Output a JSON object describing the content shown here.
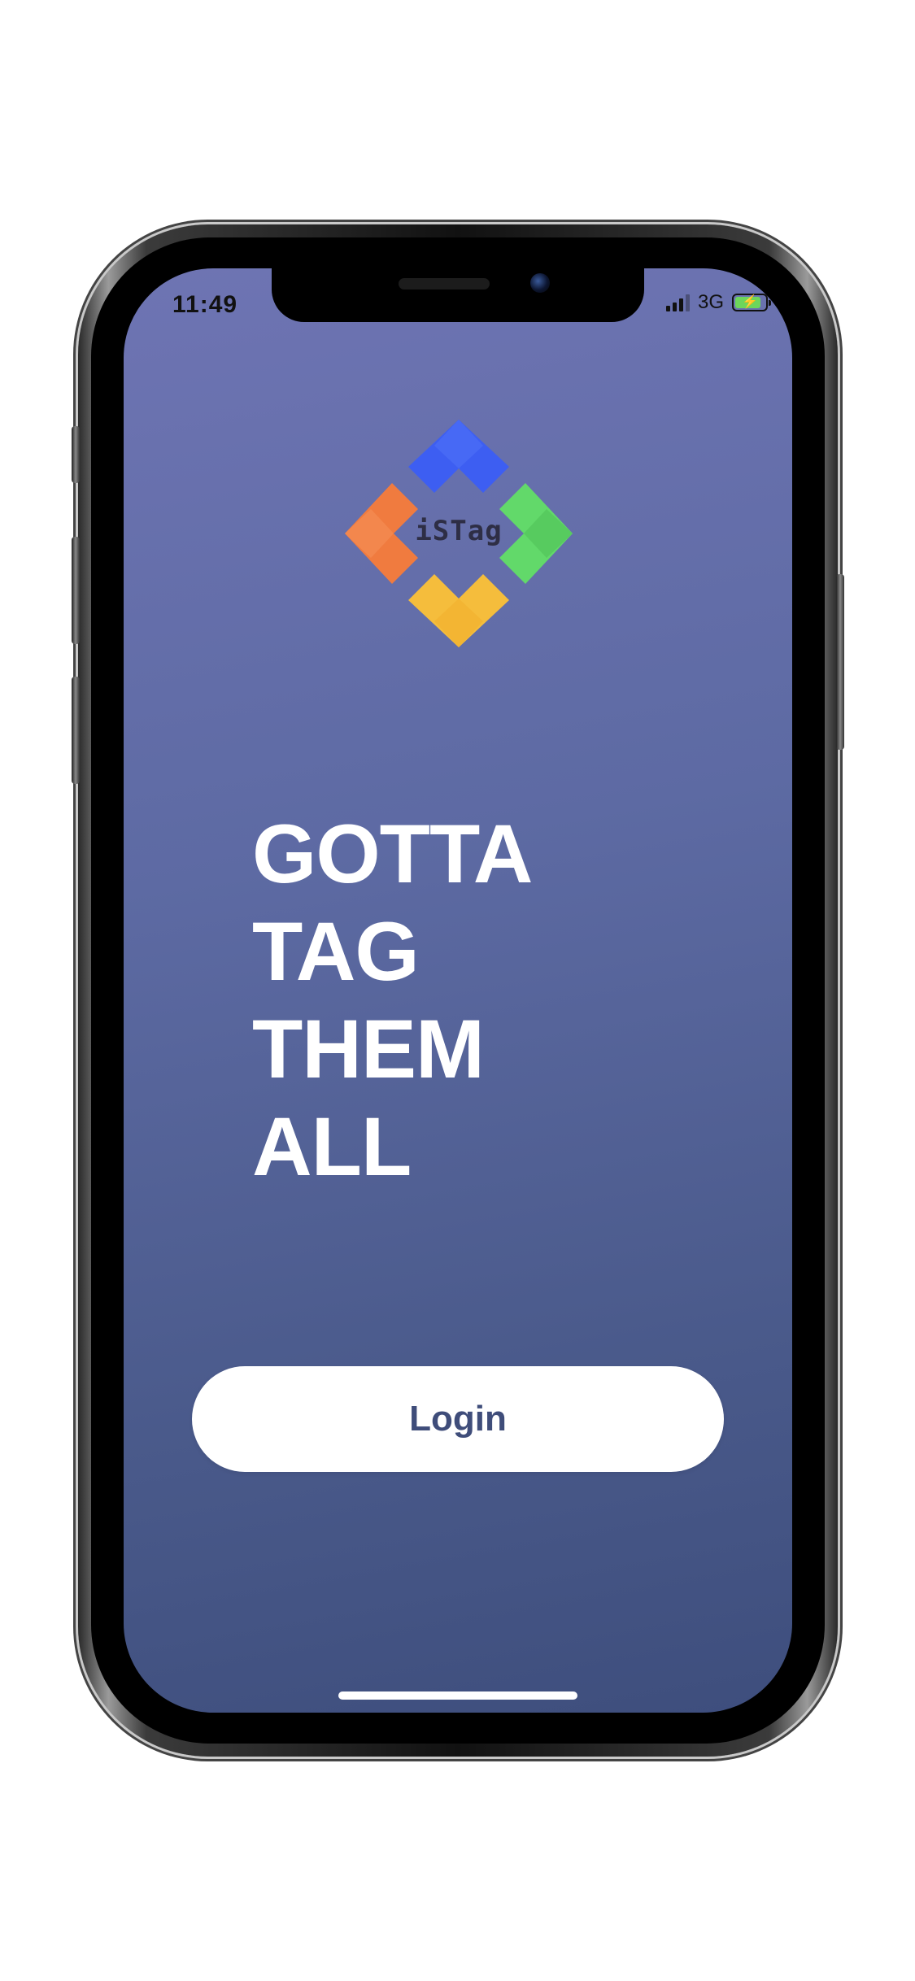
{
  "status_bar": {
    "time": "11:49",
    "network": "3G",
    "signal_icon": "signal-bars-icon",
    "battery_icon": "battery-charging-icon",
    "battery_color": "#6dd65b"
  },
  "logo": {
    "text": "iSTag",
    "icon": "istag-diamond-logo",
    "colors": {
      "top": "#3d5ef2",
      "left": "#f07b3f",
      "right": "#62d96a",
      "bottom": "#f5bd3c"
    }
  },
  "tagline": {
    "line1": "GOTTA",
    "line2": "TAG",
    "line3": "THEM",
    "line4": "ALL"
  },
  "login": {
    "label": "Login"
  },
  "theme": {
    "background_top": "#6e74b3",
    "background_bottom": "#3e4e7d",
    "button_text": "#3f4d7a"
  }
}
